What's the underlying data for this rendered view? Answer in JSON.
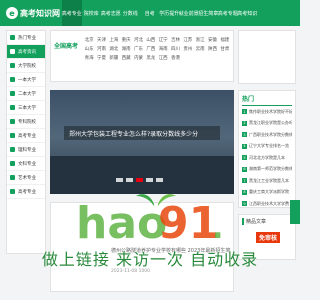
{
  "header": {
    "logo_text": "高考知识网",
    "logo_mark": "e",
    "nav": [
      "高考专业",
      "院校库",
      "高考志愿",
      "分数线",
      "自考",
      "学历提升",
      "就业前景",
      "招生简章",
      "高考专题",
      "高考知识"
    ]
  },
  "sidebar": {
    "items": [
      "热门专业",
      "高考资讯",
      "大学院校",
      "一本大学",
      "二本大学",
      "三本大学",
      "专科院校",
      "高考专业",
      "理科专业",
      "文科专业",
      "艺术专业",
      "高考专业"
    ]
  },
  "region": {
    "title": "全国高考",
    "cells": [
      "北京",
      "天津",
      "上海",
      "重庆",
      "河北",
      "山西",
      "辽宁",
      "吉林",
      "江苏",
      "浙江",
      "安徽",
      "福建",
      "山东",
      "河南",
      "湖北",
      "湖南",
      "广东",
      "广西",
      "海南",
      "四川",
      "贵州",
      "云南",
      "陕西",
      "甘肃",
      "青海",
      "宁夏",
      "新疆",
      "西藏",
      "内蒙",
      "黑龙",
      "江西",
      "香港"
    ]
  },
  "banner": {
    "caption": "郑州大学包装工程专业怎么样?录取分数线多少分",
    "dots": 5,
    "active_dot": 2
  },
  "articles": {
    "title": "德州公路隧道养护专业学校有哪些 2023年最新招生简章",
    "meta": "2023-11-08  1000"
  },
  "hot": {
    "title": "热门",
    "items": [
      "焦作职业技术学院好不好",
      "黑龙江职业学院是公办吗",
      "广西职业技术学院分数线",
      "辽宁大学专业排名一览",
      "河北北方学院是几本",
      "湖南第一师范学院分数线",
      "黑龙江工业学院是几本",
      "重庆工商大学派斯学院",
      "江西职业技术大学学费"
    ]
  },
  "recommend": {
    "title": "精品文章",
    "badge": "免审核"
  },
  "watermark": {
    "slogan": "做上链接  来访一次  自动收录"
  },
  "colors": {
    "brand": "#12a05c",
    "accent": "#e60012"
  }
}
